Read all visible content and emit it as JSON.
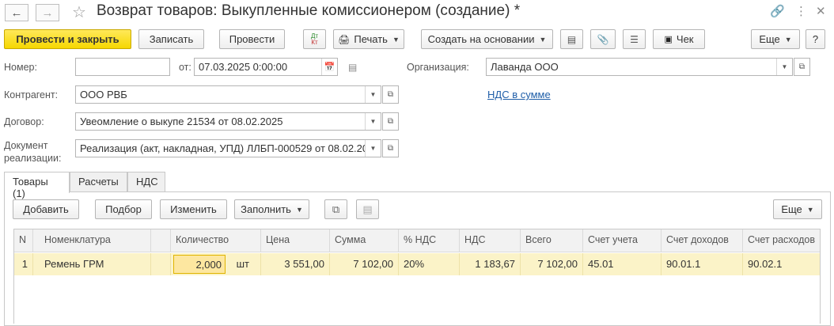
{
  "window": {
    "title": "Возврат товаров: Выкупленные комиссионером (создание) *"
  },
  "toolbar": {
    "post_close": "Провести и закрыть",
    "save": "Записать",
    "post": "Провести",
    "dtkt_top": "Дт",
    "dtkt_bottom": "Кт",
    "print": "Печать",
    "create_based": "Создать на основании",
    "receipt": "Чек",
    "more": "Еще",
    "help": "?"
  },
  "form": {
    "number_label": "Номер:",
    "number_value": "",
    "date_label": "от:",
    "date_value": "07.03.2025  0:00:00",
    "org_label": "Организация:",
    "org_value": "Лаванда ООО",
    "counterparty_label": "Контрагент:",
    "counterparty_value": "ООО РВБ",
    "vat_link": "НДС в сумме",
    "contract_label": "Договор:",
    "contract_value": "Увеомление о выкупе 21534 от 08.02.2025",
    "realization_label_1": "Документ",
    "realization_label_2": "реализации:",
    "realization_value": "Реализация (акт, накладная, УПД) ЛЛБП-000529 от 08.02.20"
  },
  "tabs": [
    {
      "label": "Товары (1)"
    },
    {
      "label": "Расчеты"
    },
    {
      "label": "НДС"
    }
  ],
  "table_toolbar": {
    "add": "Добавить",
    "select": "Подбор",
    "change": "Изменить",
    "fill": "Заполнить",
    "more": "Еще"
  },
  "table": {
    "headers": [
      "N",
      "Номенклатура",
      "Количество",
      "Цена",
      "Сумма",
      "% НДС",
      "НДС",
      "Всего",
      "Счет учета",
      "Счет доходов",
      "Счет расходов"
    ],
    "rows": [
      {
        "n": "1",
        "item": "Ремень ГРМ",
        "qty": "2,000",
        "unit": "шт",
        "price": "3 551,00",
        "sum": "7 102,00",
        "vat_rate": "20%",
        "vat": "1 183,67",
        "total": "7 102,00",
        "account": "45.01",
        "income_account": "90.01.1",
        "expense_account": "90.02.1"
      }
    ]
  }
}
